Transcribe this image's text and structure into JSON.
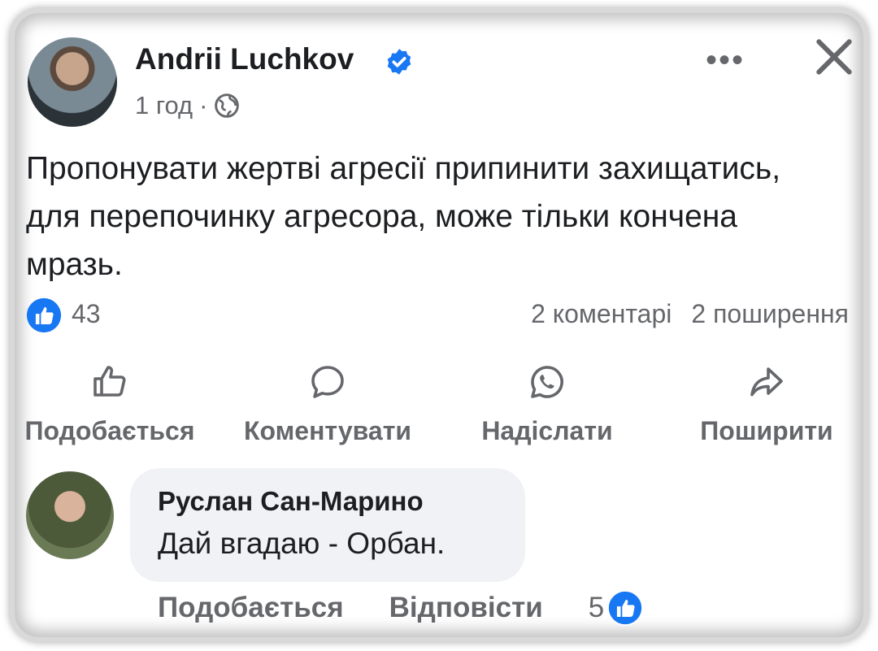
{
  "post": {
    "author": "Andrii Luchkov",
    "time": "1 год",
    "separator": "·",
    "more_label": "•••",
    "text": "Пропонувати жертві агресії припинити захищатись, для перепочинку агресора, може тільки кончена мразь.",
    "likes": "43",
    "comments": "2 коментарі",
    "shares": "2 поширення"
  },
  "actions": {
    "like": "Подобається",
    "comment": "Коментувати",
    "send": "Надіслати",
    "share": "Поширити"
  },
  "comment": {
    "author": "Руслан Сан-Марино",
    "text": "Дай вгадаю - Орбан.",
    "like_label": "Подобається",
    "reply_label": "Відповісти",
    "likes": "5"
  },
  "colors": {
    "accent": "#1877f2",
    "secondary_text": "#65676b",
    "primary_text": "#1c1e21",
    "bubble": "#f0f2f5"
  }
}
